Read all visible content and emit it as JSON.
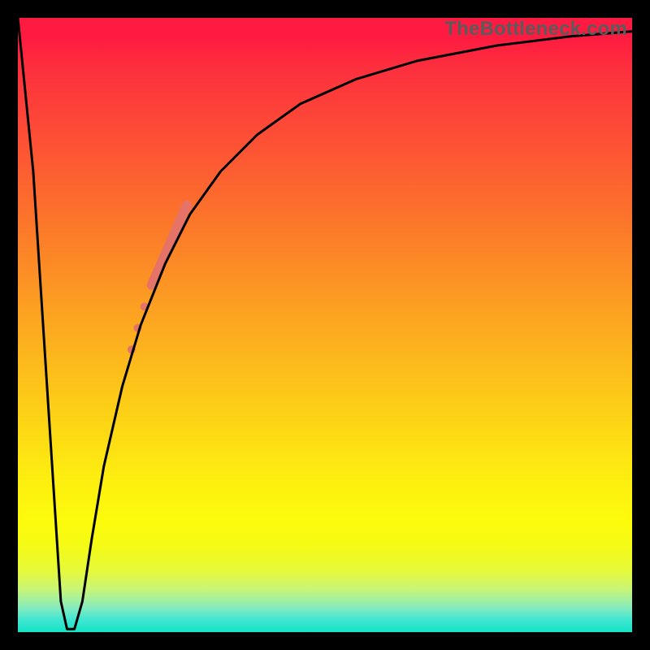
{
  "watermark": {
    "text": "TheBottleneck.com"
  },
  "chart_data": {
    "type": "line",
    "title": "",
    "xlabel": "",
    "ylabel": "",
    "xlim": [
      0,
      100
    ],
    "ylim": [
      0,
      100
    ],
    "grid": false,
    "series": [
      {
        "name": "bottleneck-curve",
        "color": "#000000",
        "x": [
          0.0,
          2.5,
          7.0,
          8.0,
          9.2,
          10.5,
          12.0,
          14.0,
          17.0,
          20.0,
          24.0,
          28.0,
          33.0,
          39.0,
          46.0,
          55.0,
          65.0,
          78.0,
          90.0,
          100.0
        ],
        "values": [
          100.0,
          75.0,
          5.0,
          0.5,
          0.5,
          5.0,
          15.0,
          27.0,
          40.0,
          50.0,
          60.0,
          68.0,
          75.0,
          81.0,
          86.0,
          90.0,
          93.0,
          95.5,
          97.0,
          97.8
        ]
      }
    ],
    "data_marks": {
      "name": "highlighted-segment",
      "color": "#e57368",
      "points": [
        {
          "x": 18.5,
          "y": 46.0,
          "r": 5
        },
        {
          "x": 19.5,
          "y": 49.5,
          "r": 5
        },
        {
          "x": 20.6,
          "y": 53.0,
          "r": 5
        }
      ],
      "bar": {
        "x1": 21.8,
        "y1": 56.5,
        "x2": 27.5,
        "y2": 69.5,
        "width": 12
      }
    }
  }
}
